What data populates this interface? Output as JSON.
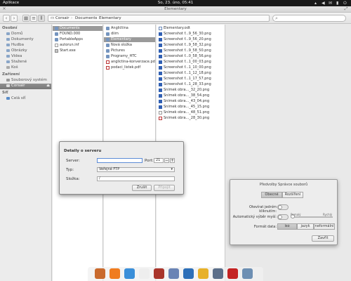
{
  "panel": {
    "apps_label": "Aplikace",
    "clock": "So, 23. úno, 05:41",
    "indicators": [
      {
        "name": "network-icon",
        "glyph": "▴"
      },
      {
        "name": "volume-icon",
        "glyph": "◀"
      },
      {
        "name": "mail-icon",
        "glyph": "✉"
      },
      {
        "name": "battery-icon",
        "glyph": "▮"
      },
      {
        "name": "power-icon",
        "glyph": "⏻"
      }
    ]
  },
  "window": {
    "title": "Elementary",
    "breadcrumb": [
      "Corsair",
      "Documents",
      "Elementary"
    ]
  },
  "sidebar": {
    "sections": [
      {
        "title": "Osobní",
        "items": [
          "Domů",
          "Dokumenty",
          "Hudba",
          "Obrázky",
          "Videa",
          "Stažené",
          "Koš"
        ]
      },
      {
        "title": "Zařízení",
        "items": [
          "Souborový systém",
          "Corsair"
        ]
      },
      {
        "title": "Síť",
        "items": [
          "Celá síť"
        ]
      }
    ],
    "selected": "Corsair"
  },
  "columns": [
    {
      "items": [
        {
          "label": "Documents",
          "kind": "folder",
          "selected": true
        },
        {
          "label": "FOUND.000",
          "kind": "folder"
        },
        {
          "label": "PortableApps",
          "kind": "folder"
        },
        {
          "label": "autorun.inf",
          "kind": "file"
        },
        {
          "label": "Start.exe",
          "kind": "exe"
        }
      ]
    },
    {
      "items": [
        {
          "label": "Angličtina",
          "kind": "folder"
        },
        {
          "label": "diim",
          "kind": "folder"
        },
        {
          "label": "Elementary",
          "kind": "folder",
          "selected": true
        },
        {
          "label": "Nová složka",
          "kind": "folder"
        },
        {
          "label": "Pictures",
          "kind": "folder"
        },
        {
          "label": "Programy_HTC",
          "kind": "folder"
        },
        {
          "label": "anglictina-konverzace.pdf",
          "kind": "pdf"
        },
        {
          "label": "podaci_listek.pdf",
          "kind": "pdf"
        }
      ]
    },
    {
      "items": [
        {
          "label": "Elementary.odt",
          "kind": "doc"
        },
        {
          "label": "Screenshot f...9_56_30.png",
          "kind": "img"
        },
        {
          "label": "Screenshot f...9_56_20.png",
          "kind": "img"
        },
        {
          "label": "Screenshot f...9_58_32.png",
          "kind": "img"
        },
        {
          "label": "Screenshot f...9_58_50.png",
          "kind": "img"
        },
        {
          "label": "Screenshot f...0_58_56.png",
          "kind": "img"
        },
        {
          "label": "Screenshot f...1_00_03.png",
          "kind": "img"
        },
        {
          "label": "Screenshot f...1_10_00.png",
          "kind": "img"
        },
        {
          "label": "Screenshot f...1_12_18.png",
          "kind": "img"
        },
        {
          "label": "Screenshot f...1_17_57.png",
          "kind": "img"
        },
        {
          "label": "Screenshot f...1_28_33.png",
          "kind": "img"
        },
        {
          "label": "Snímek obra..._32_20.png",
          "kind": "img"
        },
        {
          "label": "Snímek obra..._38_54.png",
          "kind": "img"
        },
        {
          "label": "Snímek obra..._43_04.png",
          "kind": "img"
        },
        {
          "label": "Snímek obra..._45_15.png",
          "kind": "img"
        },
        {
          "label": "Snímek obra..._48_51.png",
          "kind": "file"
        },
        {
          "label": "Snímek obra..._28_30.png",
          "kind": "pdf"
        }
      ]
    }
  ],
  "connect_dialog": {
    "title": "Detaily o serveru",
    "server_label": "Server:",
    "server_value": "",
    "port_label": "Port:",
    "port_value": "21",
    "type_label": "Typ:",
    "type_value": "Veřejné FTP",
    "folder_label": "Složka:",
    "folder_value": "/",
    "cancel_label": "Zrušit",
    "connect_label": "Připojit"
  },
  "prefs_dialog": {
    "title": "Předvolby Správce souborů",
    "tabs": [
      "Obecné",
      "Rozšíření"
    ],
    "selected_tab": "Obecné",
    "single_click_label": "Otevírat jedním kliknutím:",
    "auto_select_label": "Automatický výběr myší:",
    "slider_left": "Pomalý",
    "slider_right": "Rychlý",
    "slider_level": 0,
    "date_format_label": "Formát data:",
    "date_formats": [
      "iso",
      "jazyk",
      "neformální"
    ],
    "selected_format": "iso",
    "close_label": "Zavřít"
  },
  "dock": {
    "apps": [
      {
        "name": "files-app-icon",
        "color": "#c96a2d"
      },
      {
        "name": "music-app-icon",
        "color": "#f07c1f"
      },
      {
        "name": "download-app-icon",
        "color": "#3b8fd9"
      },
      {
        "name": "info-app-icon",
        "color": "#eeeeee"
      },
      {
        "name": "store-app-icon",
        "color": "#a9352b"
      },
      {
        "name": "photos-app-icon",
        "color": "#6a84b5"
      },
      {
        "name": "browser-app-icon",
        "color": "#2d6fb8"
      },
      {
        "name": "mail-app-icon",
        "color": "#e7b12a"
      },
      {
        "name": "windows-app-icon",
        "color": "#5c6f8a"
      },
      {
        "name": "media-app-icon",
        "color": "#c42222"
      },
      {
        "name": "terminal-app-icon",
        "color": "#6d8fb3"
      }
    ]
  }
}
